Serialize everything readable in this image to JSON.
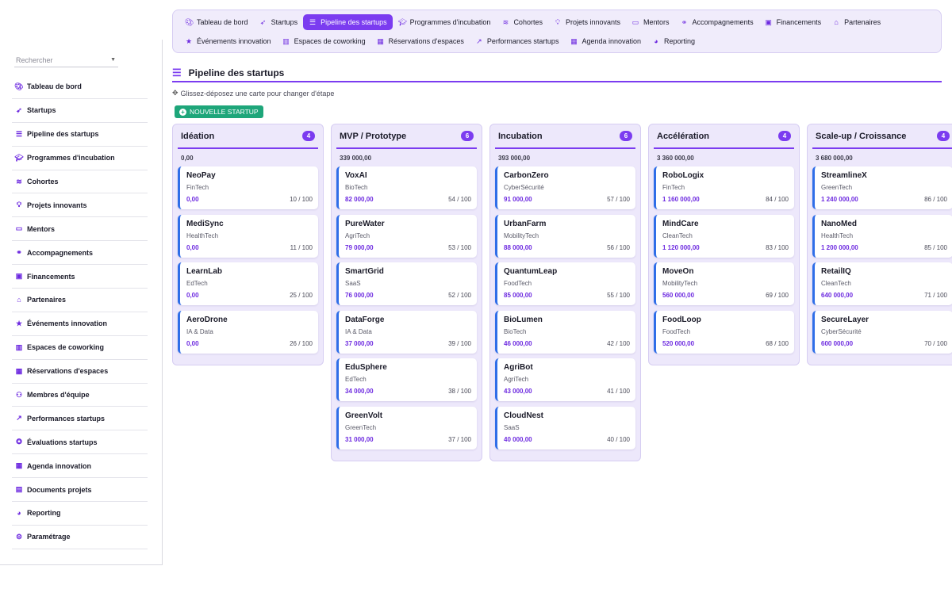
{
  "sidebar": {
    "search_placeholder": "Rechercher",
    "items": [
      {
        "label": "Tableau de bord",
        "icon": "palette-icon"
      },
      {
        "label": "Startups",
        "icon": "rocket-icon"
      },
      {
        "label": "Pipeline des startups",
        "icon": "bars-icon"
      },
      {
        "label": "Programmes d'incubation",
        "icon": "graduation-cap-icon"
      },
      {
        "label": "Cohortes",
        "icon": "layers-icon"
      },
      {
        "label": "Projets innovants",
        "icon": "lightbulb-icon"
      },
      {
        "label": "Mentors",
        "icon": "chalkboard-teacher-icon"
      },
      {
        "label": "Accompagnements",
        "icon": "handshake-icon"
      },
      {
        "label": "Financements",
        "icon": "money-bill-icon"
      },
      {
        "label": "Partenaires",
        "icon": "landmark-icon"
      },
      {
        "label": "Événements innovation",
        "icon": "star-icon"
      },
      {
        "label": "Espaces de coworking",
        "icon": "building-icon"
      },
      {
        "label": "Réservations d'espaces",
        "icon": "calendar-check-icon"
      },
      {
        "label": "Membres d'équipe",
        "icon": "users-icon"
      },
      {
        "label": "Performances startups",
        "icon": "chart-line-icon"
      },
      {
        "label": "Évaluations startups",
        "icon": "award-icon"
      },
      {
        "label": "Agenda innovation",
        "icon": "calendar-icon"
      },
      {
        "label": "Documents projets",
        "icon": "file-icon"
      },
      {
        "label": "Reporting",
        "icon": "pie-chart-icon"
      },
      {
        "label": "Paramétrage",
        "icon": "gear-icon"
      }
    ]
  },
  "topnav": {
    "row1": [
      {
        "label": "Tableau de bord",
        "icon": "palette-icon",
        "active": false
      },
      {
        "label": "Startups",
        "icon": "rocket-icon",
        "active": false
      },
      {
        "label": "Pipeline des startups",
        "icon": "bars-icon",
        "active": true
      },
      {
        "label": "Programmes d'incubation",
        "icon": "graduation-cap-icon",
        "active": false
      },
      {
        "label": "Cohortes",
        "icon": "layers-icon",
        "active": false
      },
      {
        "label": "Projets innovants",
        "icon": "lightbulb-icon",
        "active": false
      },
      {
        "label": "Mentors",
        "icon": "chalkboard-teacher-icon",
        "active": false
      },
      {
        "label": "Accompagnements",
        "icon": "handshake-icon",
        "active": false
      },
      {
        "label": "Financements",
        "icon": "money-bill-icon",
        "active": false
      },
      {
        "label": "Partenaires",
        "icon": "landmark-icon",
        "active": false
      }
    ],
    "row2": [
      {
        "label": "Événements innovation",
        "icon": "star-icon",
        "active": false
      },
      {
        "label": "Espaces de coworking",
        "icon": "building-icon",
        "active": false
      },
      {
        "label": "Réservations d'espaces",
        "icon": "calendar-check-icon",
        "active": false
      },
      {
        "label": "Performances startups",
        "icon": "chart-line-icon",
        "active": false
      },
      {
        "label": "Agenda innovation",
        "icon": "calendar-icon",
        "active": false
      },
      {
        "label": "Reporting",
        "icon": "pie-chart-icon",
        "active": false
      }
    ]
  },
  "page": {
    "title": "Pipeline des startups",
    "hint": "Glissez-déposez une carte pour changer d'étape",
    "new_button": "Nouvelle startup"
  },
  "columns": [
    {
      "title": "Idéation",
      "count": "4",
      "total": "0,00",
      "cards": [
        {
          "name": "NeoPay",
          "sector": "FinTech",
          "amount": "0,00",
          "score": "10 / 100"
        },
        {
          "name": "MediSync",
          "sector": "HealthTech",
          "amount": "0,00",
          "score": "11 / 100"
        },
        {
          "name": "LearnLab",
          "sector": "EdTech",
          "amount": "0,00",
          "score": "25 / 100"
        },
        {
          "name": "AeroDrone",
          "sector": "IA & Data",
          "amount": "0,00",
          "score": "26 / 100"
        }
      ]
    },
    {
      "title": "MVP / Prototype",
      "count": "6",
      "total": "339 000,00",
      "cards": [
        {
          "name": "VoxAI",
          "sector": "BioTech",
          "amount": "82 000,00",
          "score": "54 / 100"
        },
        {
          "name": "PureWater",
          "sector": "AgriTech",
          "amount": "79 000,00",
          "score": "53 / 100"
        },
        {
          "name": "SmartGrid",
          "sector": "SaaS",
          "amount": "76 000,00",
          "score": "52 / 100"
        },
        {
          "name": "DataForge",
          "sector": "IA & Data",
          "amount": "37 000,00",
          "score": "39 / 100"
        },
        {
          "name": "EduSphere",
          "sector": "EdTech",
          "amount": "34 000,00",
          "score": "38 / 100"
        },
        {
          "name": "GreenVolt",
          "sector": "GreenTech",
          "amount": "31 000,00",
          "score": "37 / 100"
        }
      ]
    },
    {
      "title": "Incubation",
      "count": "6",
      "total": "393 000,00",
      "cards": [
        {
          "name": "CarbonZero",
          "sector": "CyberSécurité",
          "amount": "91 000,00",
          "score": "57 / 100"
        },
        {
          "name": "UrbanFarm",
          "sector": "MobilityTech",
          "amount": "88 000,00",
          "score": "56 / 100"
        },
        {
          "name": "QuantumLeap",
          "sector": "FoodTech",
          "amount": "85 000,00",
          "score": "55 / 100"
        },
        {
          "name": "BioLumen",
          "sector": "BioTech",
          "amount": "46 000,00",
          "score": "42 / 100"
        },
        {
          "name": "AgriBot",
          "sector": "AgriTech",
          "amount": "43 000,00",
          "score": "41 / 100"
        },
        {
          "name": "CloudNest",
          "sector": "SaaS",
          "amount": "40 000,00",
          "score": "40 / 100"
        }
      ]
    },
    {
      "title": "Accélération",
      "count": "4",
      "total": "3 360 000,00",
      "cards": [
        {
          "name": "RoboLogix",
          "sector": "FinTech",
          "amount": "1 160 000,00",
          "score": "84 / 100"
        },
        {
          "name": "MindCare",
          "sector": "CleanTech",
          "amount": "1 120 000,00",
          "score": "83 / 100"
        },
        {
          "name": "MoveOn",
          "sector": "MobilityTech",
          "amount": "560 000,00",
          "score": "69 / 100"
        },
        {
          "name": "FoodLoop",
          "sector": "FoodTech",
          "amount": "520 000,00",
          "score": "68 / 100"
        }
      ]
    },
    {
      "title": "Scale-up / Croissance",
      "count": "4",
      "total": "3 680 000,00",
      "cards": [
        {
          "name": "StreamlineX",
          "sector": "GreenTech",
          "amount": "1 240 000,00",
          "score": "86 / 100"
        },
        {
          "name": "NanoMed",
          "sector": "HealthTech",
          "amount": "1 200 000,00",
          "score": "85 / 100"
        },
        {
          "name": "RetailIQ",
          "sector": "CleanTech",
          "amount": "640 000,00",
          "score": "71 / 100"
        },
        {
          "name": "SecureLayer",
          "sector": "CyberSécurité",
          "amount": "600 000,00",
          "score": "70 / 100"
        }
      ]
    }
  ],
  "colors": {
    "accent": "#7b3cf0",
    "card_border": "#2f6ee8",
    "success": "#1ea67a"
  }
}
